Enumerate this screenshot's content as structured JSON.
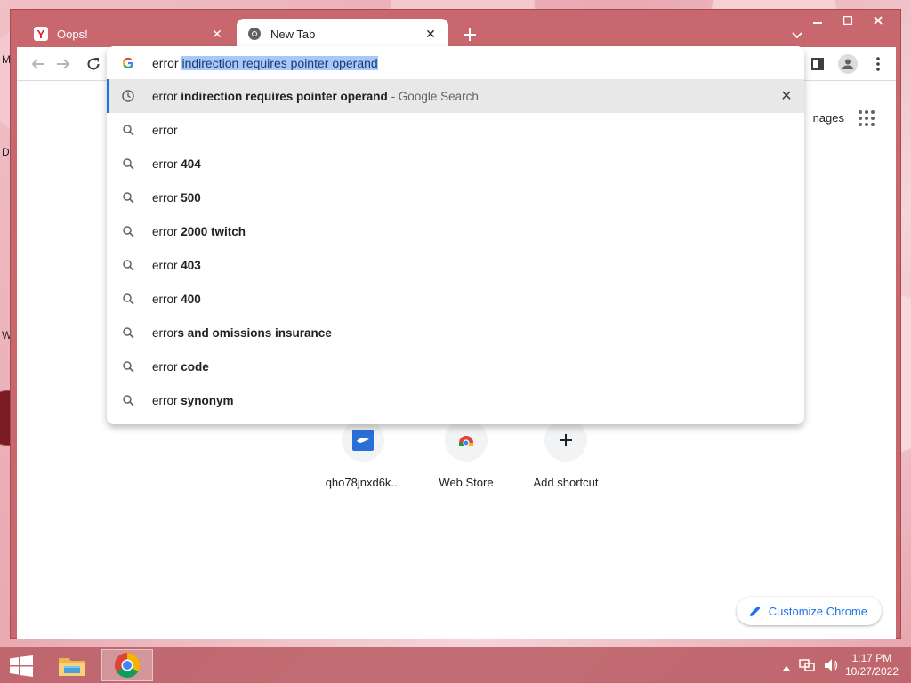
{
  "desktop": {
    "letters": [
      "M",
      "D",
      "W"
    ]
  },
  "window": {
    "tabs": [
      {
        "title": "Oops!",
        "favicon": "yandex-icon"
      },
      {
        "title": "New Tab",
        "favicon": "chrome-icon"
      }
    ]
  },
  "omnibox": {
    "typed": "error ",
    "autocomplete": "indirection requires pointer operand",
    "suggestions": [
      {
        "icon": "history-icon",
        "prefix": "error ",
        "bold": "indirection requires pointer operand",
        "desc": " - Google Search"
      },
      {
        "icon": "search-icon",
        "prefix": "error",
        "bold": "",
        "desc": ""
      },
      {
        "icon": "search-icon",
        "prefix": "error ",
        "bold": "404",
        "desc": ""
      },
      {
        "icon": "search-icon",
        "prefix": "error ",
        "bold": "500",
        "desc": ""
      },
      {
        "icon": "search-icon",
        "prefix": "error ",
        "bold": "2000 twitch",
        "desc": ""
      },
      {
        "icon": "search-icon",
        "prefix": "error ",
        "bold": "403",
        "desc": ""
      },
      {
        "icon": "search-icon",
        "prefix": "error ",
        "bold": "400",
        "desc": ""
      },
      {
        "icon": "search-icon",
        "prefix": "error",
        "bold": "s and omissions insurance",
        "desc": ""
      },
      {
        "icon": "search-icon",
        "prefix": "error ",
        "bold": "code",
        "desc": ""
      },
      {
        "icon": "search-icon",
        "prefix": "error ",
        "bold": "synonym",
        "desc": ""
      }
    ]
  },
  "page": {
    "images_link": "nages",
    "shortcuts": [
      {
        "label": "qho78jnxd6k...",
        "icon": "site-icon"
      },
      {
        "label": "Web Store",
        "icon": "web-store-icon"
      },
      {
        "label": "Add shortcut",
        "icon": "plus-icon"
      }
    ],
    "customize_label": "Customize Chrome"
  },
  "taskbar": {
    "time": "1:17 PM",
    "date": "10/27/2022"
  },
  "colors": {
    "accent": "#1a73e8",
    "frame": "#c8686e",
    "selection": "#a8c7fa"
  }
}
